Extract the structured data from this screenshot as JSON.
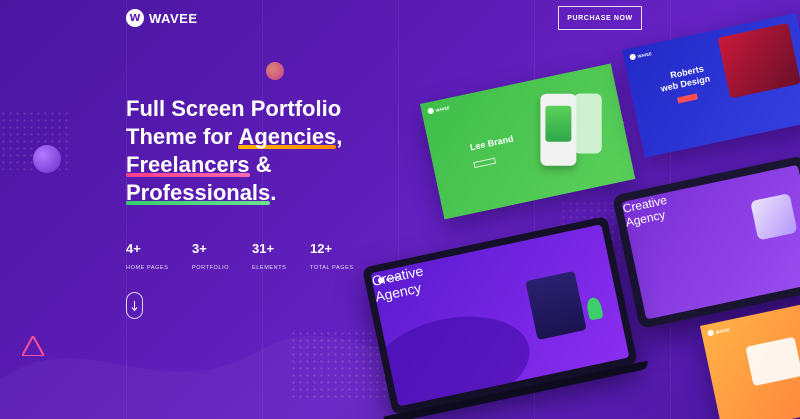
{
  "header": {
    "logo_letter": "W",
    "logo_text": "WAVEE",
    "purchase_label": "PURCHASE NOW"
  },
  "hero": {
    "line1": "Full Screen Portfolio",
    "line2_prefix": "Theme for ",
    "line2_highlight": "Agencies",
    "line2_suffix": ",",
    "line3_highlight": "Freelancers",
    "line3_suffix": " &",
    "line4_highlight": "Professionals",
    "line4_suffix": "."
  },
  "stats": [
    {
      "number": "4+",
      "label": "HOME PAGES"
    },
    {
      "number": "3+",
      "label": "PORTFOLIO"
    },
    {
      "number": "31+",
      "label": "ELEMENTS"
    },
    {
      "number": "12+",
      "label": "TOTAL PAGES"
    }
  ],
  "mockups": {
    "green_title": "Lee Brand",
    "blue_title_1": "Roberts",
    "blue_title_2": "web Design",
    "tablet_title_1": "Creative",
    "tablet_title_2": "Agency",
    "laptop_title_1": "Creative",
    "laptop_title_2": "Agency",
    "mini_logo": "WAVEE"
  },
  "colors": {
    "background": "#5a1bb3",
    "green_card": "#4cc24a",
    "blue_card": "#2c2fd0",
    "tablet_screen": "#8a3bdc",
    "orange_card": "#ff9a3c",
    "highlight_yellow": "#ffb400",
    "highlight_pink": "#ff3d8b",
    "highlight_green": "#35d06a"
  }
}
